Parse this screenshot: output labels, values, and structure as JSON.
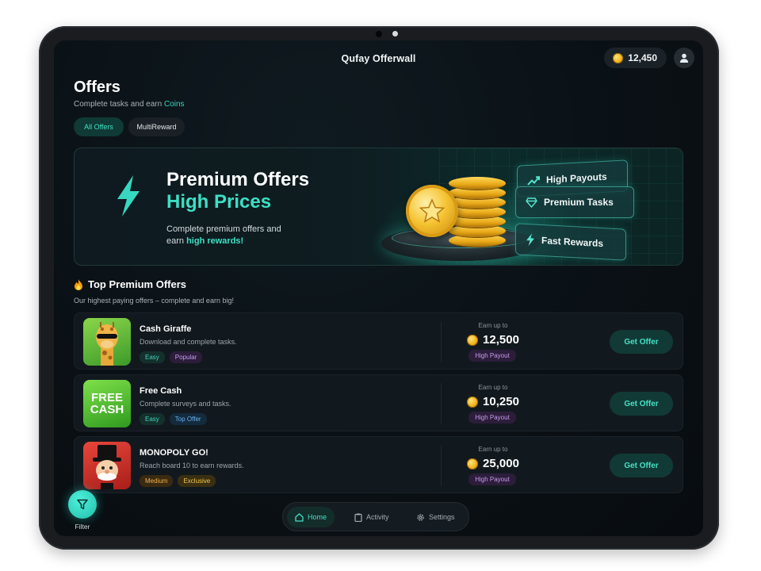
{
  "app": {
    "title": "Qufay Offerwall"
  },
  "header": {
    "coins": "12,450"
  },
  "page": {
    "title": "Offers",
    "subtitle_prefix": "Complete tasks and earn ",
    "subtitle_highlight": "Coins"
  },
  "filters": {
    "all": "All Offers",
    "multi": "MultiReward"
  },
  "hero": {
    "title_line1": "Premium Offers",
    "title_line2": "High Prices",
    "desc_line1": "Complete premium offers and",
    "desc_line2_prefix": "earn ",
    "desc_line2_highlight": "high rewards!",
    "cards": [
      "High Payouts",
      "Premium Tasks",
      "Fast Rewards"
    ]
  },
  "section": {
    "title": "Top Premium Offers",
    "subtitle": "Our highest paying offers – complete and earn big!"
  },
  "offers": [
    {
      "name": "Cash Giraffe",
      "desc": "Download and complete tasks.",
      "tags": [
        "Easy",
        "Popular"
      ],
      "earn_label": "Earn up to",
      "earn": "12,500",
      "payout": "High Payout",
      "cta": "Get Offer"
    },
    {
      "name": "Free Cash",
      "desc": "Complete surveys and tasks.",
      "tags": [
        "Easy",
        "Top Offer"
      ],
      "earn_label": "Earn up to",
      "earn": "10,250",
      "payout": "High Payout",
      "cta": "Get Offer",
      "thumb_text_1": "FREE",
      "thumb_text_2": "CASH"
    },
    {
      "name": "MONOPOLY GO!",
      "desc": "Reach board 10 to earn rewards.",
      "tags": [
        "Medium",
        "Exclusive"
      ],
      "earn_label": "Earn up to",
      "earn": "25,000",
      "payout": "High Payout",
      "cta": "Get Offer"
    }
  ],
  "fab": {
    "label": "Filter"
  },
  "nav": {
    "home": "Home",
    "activity": "Activity",
    "settings": "Settings"
  },
  "colors": {
    "accent": "#3be0c5",
    "background": "#0a1015",
    "coin": "#f2b51c"
  }
}
